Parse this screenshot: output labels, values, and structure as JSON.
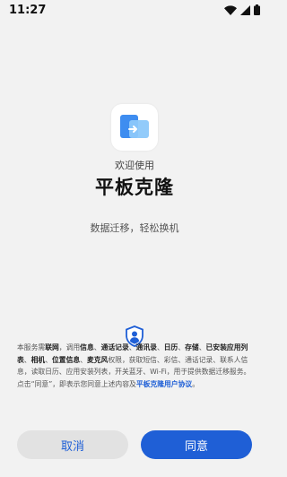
{
  "status_bar": {
    "time": "11:27",
    "icons": [
      "wifi-icon",
      "signal-icon",
      "battery-icon"
    ]
  },
  "app": {
    "icon": "device-clone-icon",
    "welcome": "欢迎使用",
    "name": "平板克隆",
    "tagline": "数据迁移，轻松换机"
  },
  "privacy": {
    "icon": "privacy-shield-icon",
    "parts": [
      {
        "text": "本服务需",
        "style": "normal"
      },
      {
        "text": "联网",
        "style": "bold"
      },
      {
        "text": "，调用",
        "style": "normal"
      },
      {
        "text": "信息",
        "style": "bold"
      },
      {
        "text": "、",
        "style": "normal"
      },
      {
        "text": "通话记录",
        "style": "bold"
      },
      {
        "text": "、",
        "style": "normal"
      },
      {
        "text": "通讯录",
        "style": "bold"
      },
      {
        "text": "、",
        "style": "normal"
      },
      {
        "text": "日历",
        "style": "bold"
      },
      {
        "text": "、",
        "style": "normal"
      },
      {
        "text": "存储",
        "style": "bold"
      },
      {
        "text": "、",
        "style": "normal"
      },
      {
        "text": "已安装应用列表",
        "style": "bold"
      },
      {
        "text": "、",
        "style": "normal"
      },
      {
        "text": "相机",
        "style": "bold"
      },
      {
        "text": "、",
        "style": "normal"
      },
      {
        "text": "位置信息",
        "style": "bold"
      },
      {
        "text": "、",
        "style": "normal"
      },
      {
        "text": "麦克风",
        "style": "bold"
      },
      {
        "text": "权限，获取短信、彩信、通话记录、联系人信息，读取日历、应用安装列表，开关蓝牙、Wi-Fi，用于提供数据迁移服务。点击“同意”，即表示您同意上述内容及",
        "style": "normal"
      },
      {
        "text": "平板克隆用户协议",
        "style": "link"
      },
      {
        "text": "。",
        "style": "normal"
      }
    ]
  },
  "buttons": {
    "cancel": "取消",
    "agree": "同意"
  },
  "colors": {
    "accent": "#1f5fd6",
    "background": "#f2f2f2"
  }
}
